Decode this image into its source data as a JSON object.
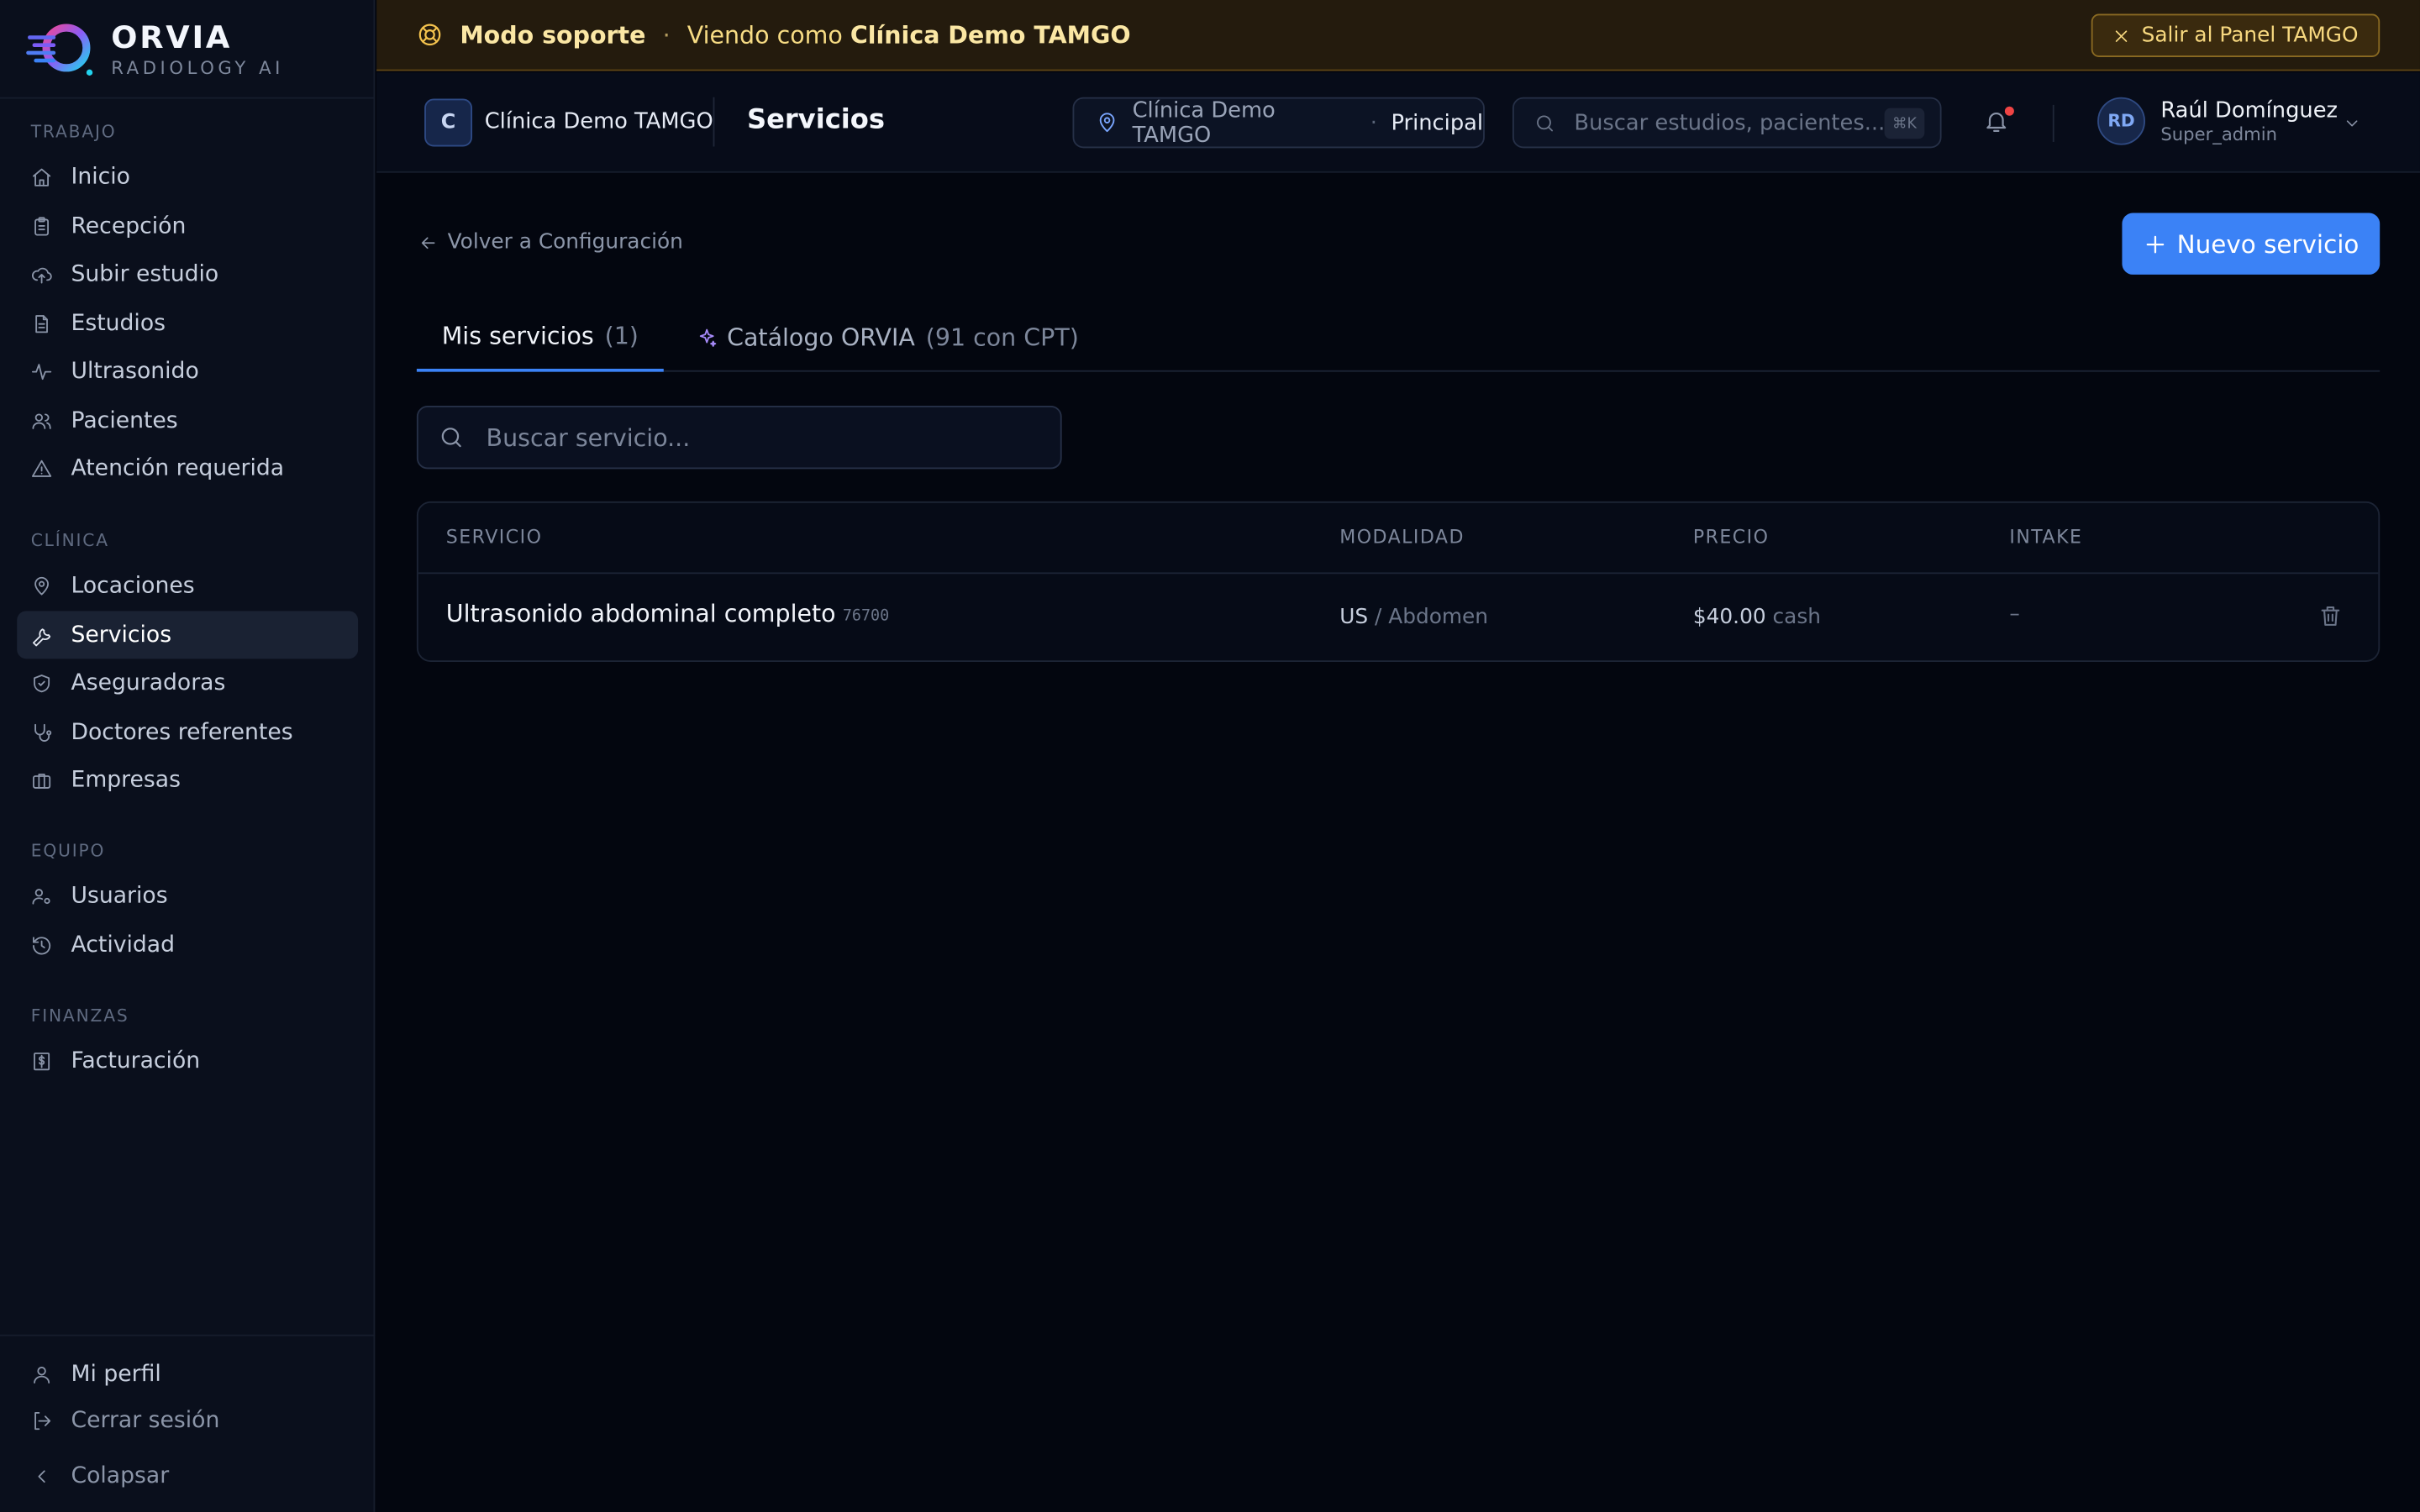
{
  "brand": {
    "name": "ORVIA",
    "subtitle": "RADIOLOGY AI"
  },
  "sidebar": {
    "sections": [
      {
        "title": "TRABAJO",
        "items": [
          {
            "label": "Inicio",
            "icon": "home-icon"
          },
          {
            "label": "Recepción",
            "icon": "clipboard-icon"
          },
          {
            "label": "Subir estudio",
            "icon": "upload-cloud-icon"
          },
          {
            "label": "Estudios",
            "icon": "file-icon"
          },
          {
            "label": "Ultrasonido",
            "icon": "activity-icon"
          },
          {
            "label": "Pacientes",
            "icon": "users-icon"
          },
          {
            "label": "Atención requerida",
            "icon": "alert-triangle-icon"
          }
        ]
      },
      {
        "title": "CLÍNICA",
        "items": [
          {
            "label": "Locaciones",
            "icon": "map-pin-icon"
          },
          {
            "label": "Servicios",
            "icon": "wrench-icon",
            "active": true
          },
          {
            "label": "Aseguradoras",
            "icon": "shield-icon"
          },
          {
            "label": "Doctores referentes",
            "icon": "stethoscope-icon"
          },
          {
            "label": "Empresas",
            "icon": "briefcase-icon"
          }
        ]
      },
      {
        "title": "EQUIPO",
        "items": [
          {
            "label": "Usuarios",
            "icon": "user-cog-icon"
          },
          {
            "label": "Actividad",
            "icon": "history-icon"
          }
        ]
      },
      {
        "title": "FINANZAS",
        "items": [
          {
            "label": "Facturación",
            "icon": "receipt-dollar-icon"
          }
        ]
      }
    ],
    "bottom": {
      "profile": "Mi perfil",
      "logout": "Cerrar sesión",
      "collapse": "Colapsar"
    }
  },
  "banner": {
    "mode": "Modo soporte",
    "separator": "·",
    "viewing_prefix": "Viendo como",
    "clinic": "Clínica Demo TAMGO",
    "exit_label": "Salir al Panel TAMGO",
    "accent": "#f4c34e"
  },
  "header": {
    "clinic_initial": "C",
    "clinic_name": "Clínica Demo TAMGO",
    "page_title": "Servicios",
    "location": {
      "clinic": "Clínica Demo TAMGO",
      "separator": "·",
      "site": "Principal"
    },
    "search_placeholder": "Buscar estudios, pacientes...",
    "search_shortcut": "⌘K",
    "notifications_unread": true,
    "user": {
      "initials": "RD",
      "name": "Raúl Domínguez",
      "role": "Super_admin"
    }
  },
  "main": {
    "back_label": "Volver a Configuración",
    "new_button": "Nuevo servicio",
    "tabs": [
      {
        "label": "Mis servicios",
        "count": "(1)",
        "active": true
      },
      {
        "label": "Catálogo ORVIA",
        "count": "(91 con CPT)",
        "icon": "sparkles-icon"
      }
    ],
    "search_placeholder": "Buscar servicio...",
    "table": {
      "columns": [
        "SERVICIO",
        "MODALIDAD",
        "PRECIO",
        "INTAKE"
      ],
      "rows": [
        {
          "name": "Ultrasonido abdominal completo",
          "code": "76700",
          "modality": "US",
          "region": "/ Abdomen",
          "price": "$40.00",
          "price_type": "cash",
          "intake": "–"
        }
      ]
    }
  },
  "colors": {
    "primary": "#3b82f6",
    "background": "#03060f",
    "sidebar": "#0a0f1c",
    "banner": "#241b0d"
  }
}
